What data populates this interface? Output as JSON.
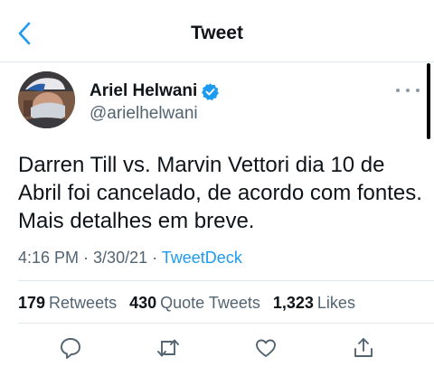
{
  "header": {
    "title": "Tweet"
  },
  "author": {
    "name": "Ariel Helwani",
    "handle": "@arielhelwani"
  },
  "tweet": {
    "text": "Darren Till vs. Marvin Vettori dia 10 de Abril foi cancelado, de acordo com fontes. Mais detalhes em breve."
  },
  "meta": {
    "time": "4:16 PM",
    "date": "3/30/21",
    "source": "TweetDeck",
    "separator": " · "
  },
  "stats": {
    "retweets": {
      "count": "179",
      "label": "Retweets"
    },
    "quotes": {
      "count": "430",
      "label": "Quote Tweets"
    },
    "likes": {
      "count": "1,323",
      "label": "Likes"
    }
  },
  "colors": {
    "accent": "#1d9bf0",
    "text": "#0f1419",
    "secondary": "#536471",
    "divider": "#e1e8ed"
  },
  "icons": [
    "back-chevron-icon",
    "verified-badge-icon",
    "more-dots-icon",
    "reply-icon",
    "retweet-icon",
    "like-icon",
    "share-icon"
  ]
}
